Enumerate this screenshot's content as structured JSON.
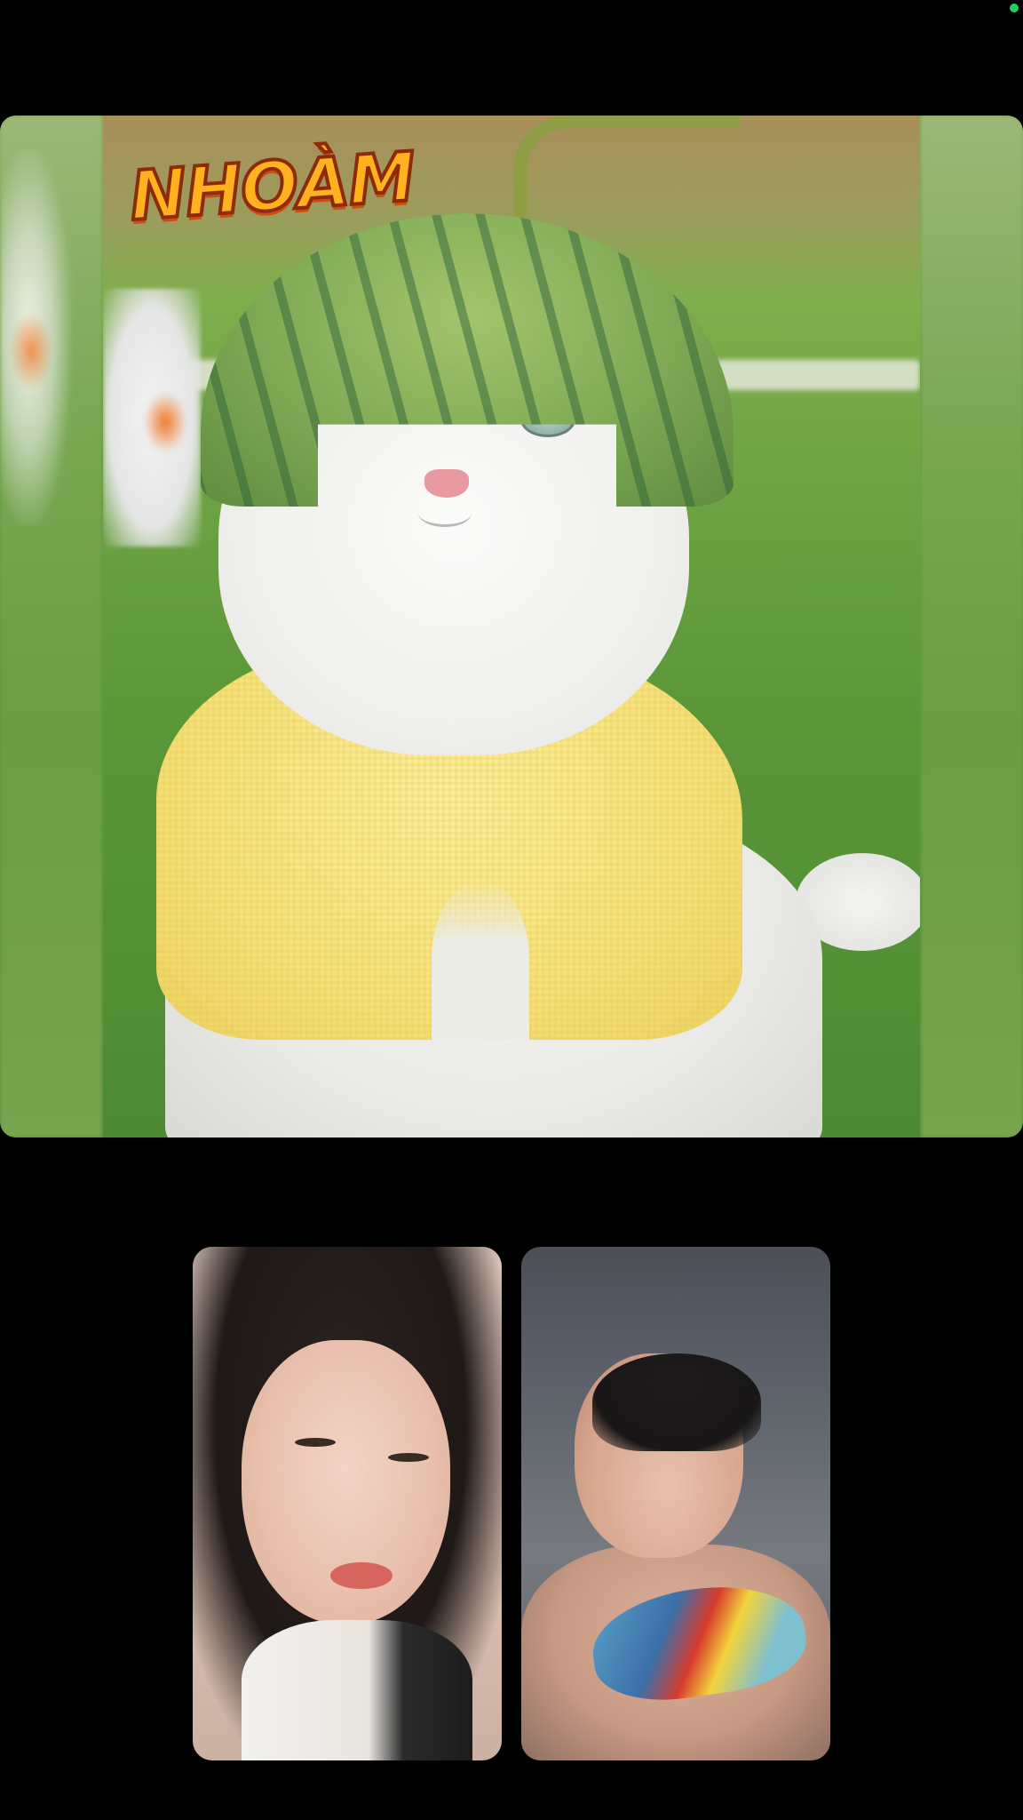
{
  "call": {
    "status_dot_color": "#1fd160",
    "shared_content": {
      "logo_text": "NHOÀM",
      "description_icon": "shared-screen"
    },
    "participants": [
      {
        "id": "participant-1"
      },
      {
        "id": "participant-2"
      }
    ]
  }
}
